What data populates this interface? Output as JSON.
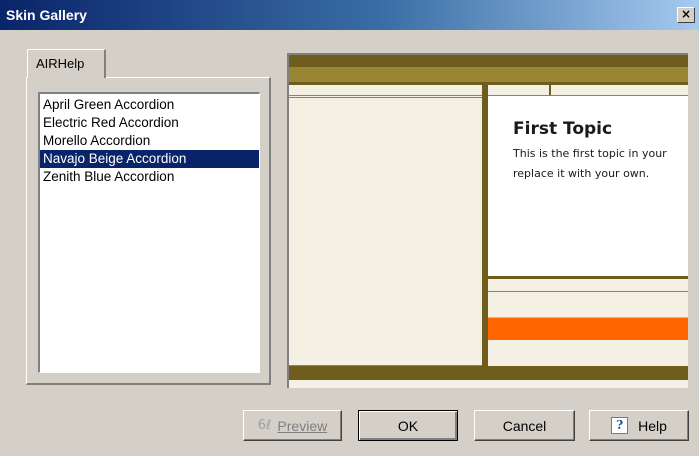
{
  "window": {
    "title": "Skin Gallery",
    "close_glyph": "×"
  },
  "tab": {
    "label": "AIRHelp"
  },
  "skins": {
    "items": [
      "April Green Accordion",
      "Electric Red Accordion",
      "Morello Accordion",
      "Navajo Beige Accordion",
      "Zenith Blue Accordion"
    ],
    "selected": "Navajo Beige Accordion"
  },
  "preview": {
    "topic_title": "First Topic",
    "topic_line1": "This is the first topic in your",
    "topic_line2": "replace it with your own.",
    "colors": {
      "dark_bar": "#6e5d1c",
      "mid_bar": "#9a8535",
      "panel_bg": "#f4f1e4",
      "accent": "#ff6600"
    }
  },
  "buttons": {
    "preview": "Preview",
    "ok": "OK",
    "cancel": "Cancel",
    "help": "Help",
    "help_glyph": "?",
    "preview_glyph": "6ℓ"
  }
}
